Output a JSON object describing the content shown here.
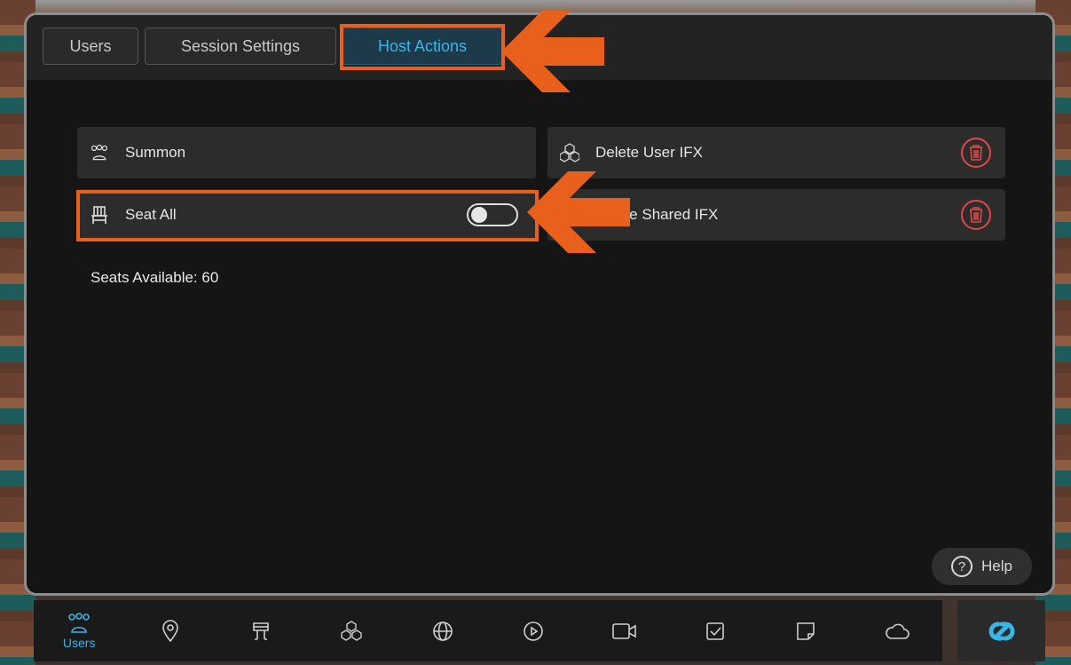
{
  "tabs": [
    {
      "label": "Users"
    },
    {
      "label": "Session Settings"
    },
    {
      "label": "Host Actions"
    }
  ],
  "active_tab": "Host Actions",
  "actions": {
    "summon": {
      "label": "Summon",
      "icon": "people-icon"
    },
    "seat_all": {
      "label": "Seat All",
      "icon": "chair-icon",
      "toggle_on": false
    },
    "delete_user_ifx": {
      "label": "Delete User IFX",
      "icon": "cubes-icon"
    },
    "delete_shared_ifx": {
      "label": "ete Shared IFX",
      "icon": "shared-cubes-icon"
    }
  },
  "seats_available": "Seats Available: 60",
  "help": {
    "label": "Help",
    "glyph": "?"
  },
  "toolbar": {
    "items": [
      {
        "icon": "users-icon",
        "label": "Users",
        "active": true
      },
      {
        "icon": "location-pin-icon"
      },
      {
        "icon": "avatar-icon"
      },
      {
        "icon": "cubes-icon"
      },
      {
        "icon": "globe-icon"
      },
      {
        "icon": "play-icon"
      },
      {
        "icon": "video-camera-icon"
      },
      {
        "icon": "checkbox-icon"
      },
      {
        "icon": "sticky-note-icon"
      },
      {
        "icon": "cloud-icon"
      }
    ],
    "brand_icon": "link-logo-icon"
  },
  "colors": {
    "accent": "#39b5e8",
    "highlight": "#e8601c",
    "danger": "#e14848",
    "panel": "#151515"
  }
}
